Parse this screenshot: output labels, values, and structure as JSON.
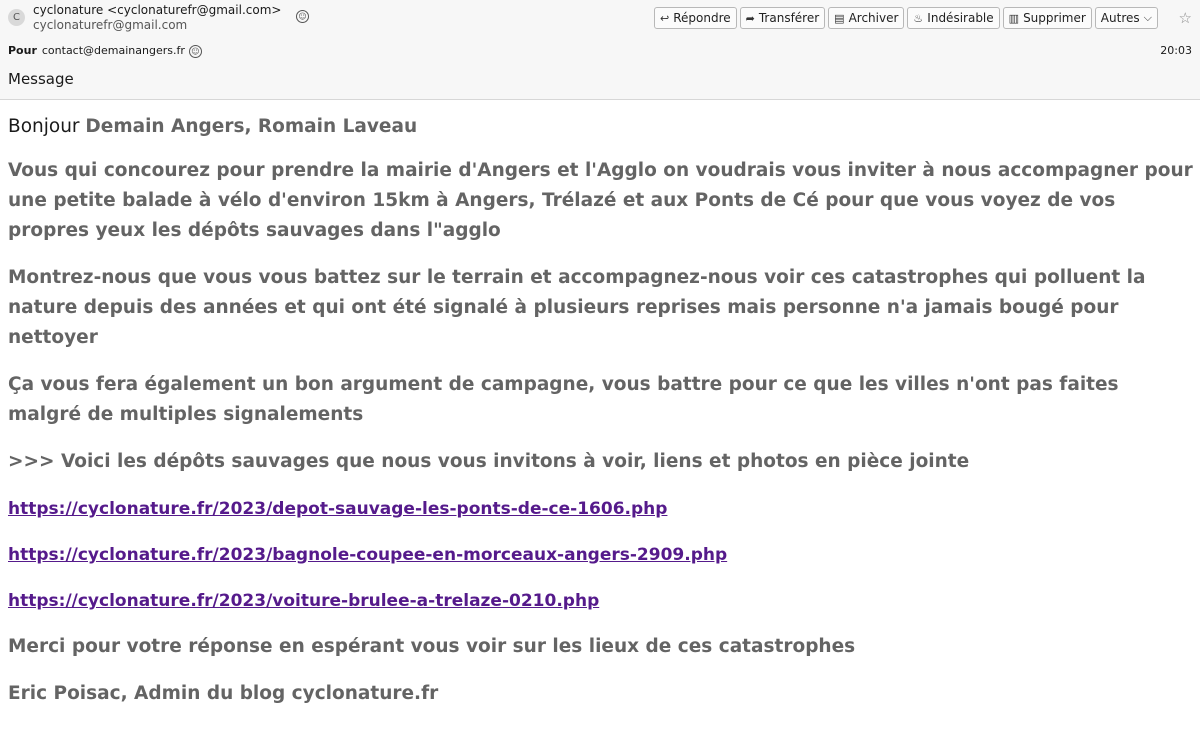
{
  "header": {
    "avatar_letter": "C",
    "from_display": "cyclonature <cyclonaturefr@gmail.com>",
    "from_address": "cyclonaturefr@gmail.com",
    "to_label": "Pour",
    "to_address": "contact@demainangers.fr",
    "time": "20:03",
    "subject": "Message"
  },
  "toolbar": {
    "reply": "Répondre",
    "forward": "Transférer",
    "archive": "Archiver",
    "junk": "Indésirable",
    "delete": "Supprimer",
    "more": "Autres"
  },
  "message": {
    "greeting_prefix": "Bonjour",
    "greeting_names": "Demain Angers, Romain Laveau",
    "paragraphs": [
      "Vous qui concourez pour prendre la mairie d'Angers et l'Agglo  on voudrais vous inviter à nous accompagner pour une petite balade à vélo d'environ 15km à Angers, Trélazé et aux Ponts de Cé pour que vous voyez de vos propres yeux les dépôts sauvages dans l\"agglo",
      "Montrez-nous que vous vous battez sur le terrain et accompagnez-nous voir ces catastrophes qui polluent la nature depuis des années et qui ont été signalé à plusieurs reprises mais personne n'a jamais bougé pour nettoyer",
      "Ça vous fera également un bon argument de campagne, vous battre pour ce que les villes n'ont pas faites malgré de multiples signalements",
      ">>> Voici les dépôts sauvages que nous vous invitons à voir, liens et photos en pièce jointe"
    ],
    "links": [
      "https://cyclonature.fr/2023/depot-sauvage-les-ponts-de-ce-1606.php",
      "https://cyclonature.fr/2023/bagnole-coupee-en-morceaux-angers-2909.php",
      "https://cyclonature.fr/2023/voiture-brulee-a-trelaze-0210.php"
    ],
    "closing": "Merci pour votre réponse en espérant vous voir sur les lieux de ces catastrophes",
    "signature": "Eric Poisac, Admin du blog cyclonature.fr"
  }
}
